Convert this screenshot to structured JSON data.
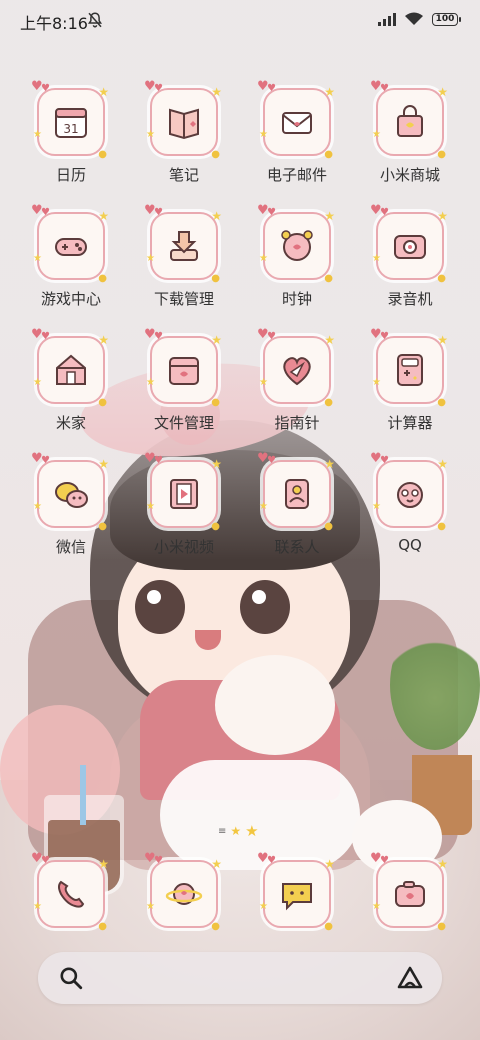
{
  "status_bar": {
    "time": "上午8:16",
    "battery": "100"
  },
  "apps": {
    "calendar": {
      "label": "日历",
      "badge": "31",
      "icon": "calendar-icon"
    },
    "notes": {
      "label": "笔记",
      "icon": "notebook-icon"
    },
    "email": {
      "label": "电子邮件",
      "icon": "envelope-icon"
    },
    "mi_store": {
      "label": "小米商城",
      "icon": "shopping-bag-icon"
    },
    "game_center": {
      "label": "游戏中心",
      "icon": "gamepad-icon"
    },
    "downloads": {
      "label": "下载管理",
      "icon": "download-icon"
    },
    "clock": {
      "label": "时钟",
      "icon": "alarm-clock-icon"
    },
    "recorder": {
      "label": "录音机",
      "icon": "recorder-icon"
    },
    "mi_home": {
      "label": "米家",
      "icon": "house-icon"
    },
    "file_manager": {
      "label": "文件管理",
      "icon": "folder-icon"
    },
    "compass": {
      "label": "指南针",
      "icon": "compass-icon"
    },
    "calculator": {
      "label": "计算器",
      "icon": "calculator-icon"
    },
    "wechat": {
      "label": "微信",
      "icon": "chat-bubble-icon"
    },
    "mi_video": {
      "label": "小米视频",
      "icon": "film-icon"
    },
    "contacts": {
      "label": "联系人",
      "icon": "contact-card-icon"
    },
    "qq": {
      "label": "QQ",
      "icon": "penguin-icon"
    }
  },
  "dock": {
    "phone": {
      "icon": "phone-icon"
    },
    "browser": {
      "icon": "planet-icon"
    },
    "messages": {
      "icon": "message-icon"
    },
    "camera": {
      "icon": "camera-icon"
    }
  },
  "colors": {
    "tile_border": "#e9a9b0",
    "tile_bg": "#fdf7f3",
    "accent_pink": "#e1727f",
    "accent_yellow": "#f3cf50"
  }
}
